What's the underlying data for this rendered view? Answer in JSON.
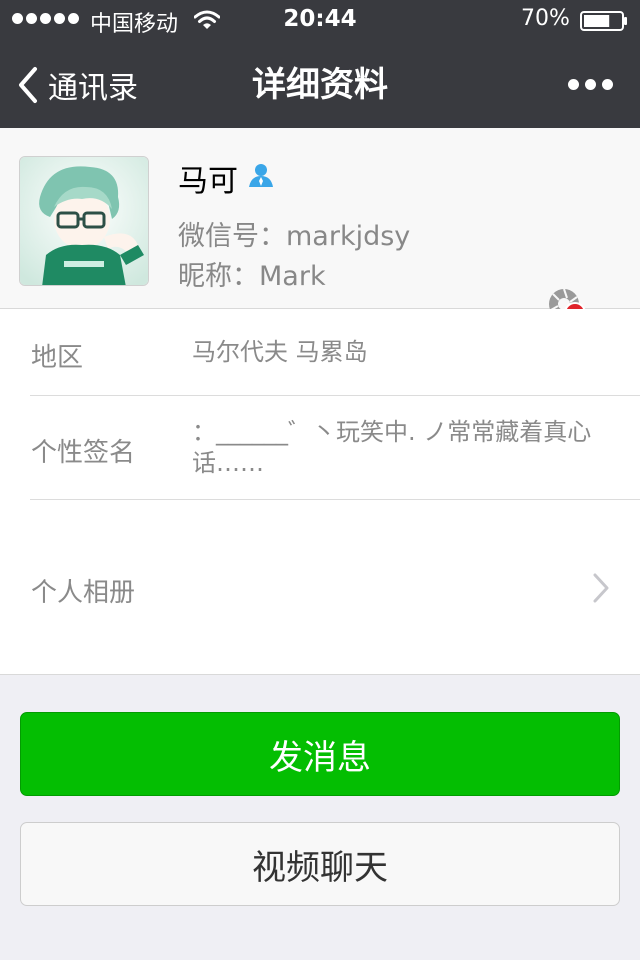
{
  "status_bar": {
    "carrier": "中国移动",
    "time": "20:44",
    "battery": "70%",
    "battery_level": 0.7,
    "icons": [
      "signal-dots-icon",
      "wifi-icon",
      "battery-icon"
    ]
  },
  "nav": {
    "back_label": "通讯录",
    "title": "详细资料",
    "icons": [
      "chevron-left-icon",
      "more-dots-icon"
    ]
  },
  "profile": {
    "name": "马可",
    "wechat_id": "微信号：markjdsy",
    "nickname": "昵称：Mark",
    "icons": [
      "avatar",
      "person-icon",
      "album-blocked-icon"
    ]
  },
  "info": {
    "region_label": "地区",
    "region_value": "马尔代夫 马累岛",
    "signature_label": "个性签名",
    "signature_value": "：______゛丶玩笑中. ノ常常藏着真心话……",
    "album_label": "个人相册"
  },
  "actions": {
    "send_message": "发消息",
    "video_chat": "视频聊天"
  },
  "colors": {
    "nav_bg": "#393a3f",
    "accent_green": "#04be02",
    "page_bg": "#efeff4",
    "verified_blue": "#3aa6e8",
    "blocked_red": "#e0242b"
  }
}
